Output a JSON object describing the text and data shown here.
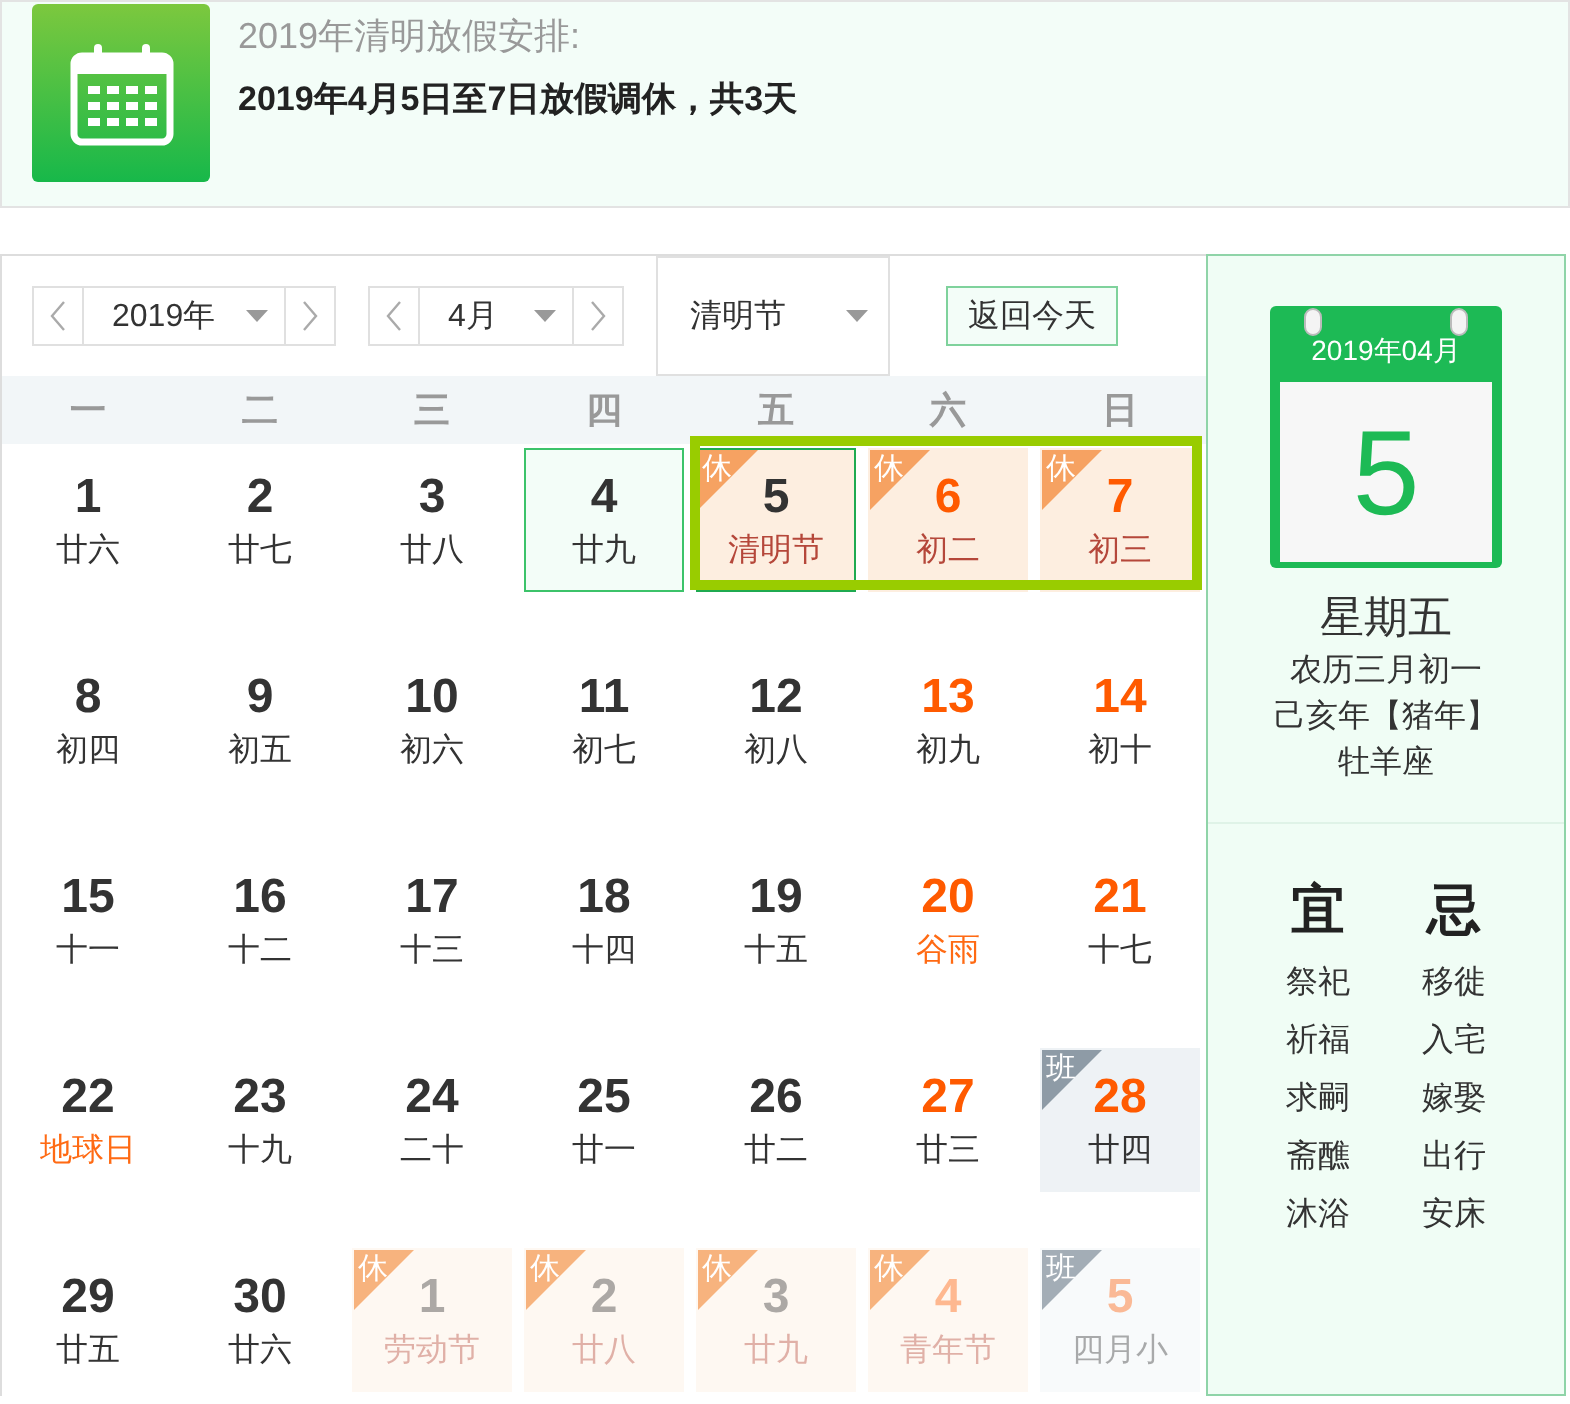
{
  "banner": {
    "title": "2019年清明放假安排:",
    "summary": "2019年4月5日至7日放假调休，共3天"
  },
  "controls": {
    "year_select": {
      "value": "2019年"
    },
    "month_select": {
      "value": "4月"
    },
    "festival_select": {
      "value": "清明节"
    },
    "today_button": "返回今天"
  },
  "weekdays": [
    "一",
    "二",
    "三",
    "四",
    "五",
    "六",
    "日"
  ],
  "weeks": [
    {
      "days": [
        {
          "day": "1",
          "lunar": "廿六",
          "weekend": false,
          "festival": false,
          "other_month": false,
          "today": false,
          "selected": false,
          "outlined": false
        },
        {
          "day": "2",
          "lunar": "廿七",
          "weekend": false,
          "festival": false,
          "other_month": false,
          "today": false,
          "selected": false,
          "outlined": false
        },
        {
          "day": "3",
          "lunar": "廿八",
          "weekend": false,
          "festival": false,
          "other_month": false,
          "today": false,
          "selected": false,
          "outlined": false
        },
        {
          "day": "4",
          "lunar": "廿九",
          "weekend": false,
          "festival": false,
          "other_month": false,
          "today": true,
          "selected": false,
          "outlined": false
        },
        {
          "day": "5",
          "lunar": "清明节",
          "weekend": false,
          "festival": true,
          "other_month": false,
          "today": false,
          "selected": true,
          "outlined": true,
          "tag": {
            "kind": "rest",
            "label": "休"
          }
        },
        {
          "day": "6",
          "lunar": "初二",
          "weekend": true,
          "festival": false,
          "other_month": false,
          "today": false,
          "selected": false,
          "outlined": true,
          "tag": {
            "kind": "rest",
            "label": "休"
          }
        },
        {
          "day": "7",
          "lunar": "初三",
          "weekend": true,
          "festival": false,
          "other_month": false,
          "today": false,
          "selected": false,
          "outlined": true,
          "tag": {
            "kind": "rest",
            "label": "休"
          }
        }
      ]
    },
    {
      "days": [
        {
          "day": "8",
          "lunar": "初四",
          "weekend": false,
          "festival": false,
          "other_month": false,
          "today": false,
          "selected": false,
          "outlined": false
        },
        {
          "day": "9",
          "lunar": "初五",
          "weekend": false,
          "festival": false,
          "other_month": false,
          "today": false,
          "selected": false,
          "outlined": false
        },
        {
          "day": "10",
          "lunar": "初六",
          "weekend": false,
          "festival": false,
          "other_month": false,
          "today": false,
          "selected": false,
          "outlined": false
        },
        {
          "day": "11",
          "lunar": "初七",
          "weekend": false,
          "festival": false,
          "other_month": false,
          "today": false,
          "selected": false,
          "outlined": false
        },
        {
          "day": "12",
          "lunar": "初八",
          "weekend": false,
          "festival": false,
          "other_month": false,
          "today": false,
          "selected": false,
          "outlined": false
        },
        {
          "day": "13",
          "lunar": "初九",
          "weekend": true,
          "festival": false,
          "other_month": false,
          "today": false,
          "selected": false,
          "outlined": false
        },
        {
          "day": "14",
          "lunar": "初十",
          "weekend": true,
          "festival": false,
          "other_month": false,
          "today": false,
          "selected": false,
          "outlined": false
        }
      ]
    },
    {
      "days": [
        {
          "day": "15",
          "lunar": "十一",
          "weekend": false,
          "festival": false,
          "other_month": false,
          "today": false,
          "selected": false,
          "outlined": false
        },
        {
          "day": "16",
          "lunar": "十二",
          "weekend": false,
          "festival": false,
          "other_month": false,
          "today": false,
          "selected": false,
          "outlined": false
        },
        {
          "day": "17",
          "lunar": "十三",
          "weekend": false,
          "festival": false,
          "other_month": false,
          "today": false,
          "selected": false,
          "outlined": false
        },
        {
          "day": "18",
          "lunar": "十四",
          "weekend": false,
          "festival": false,
          "other_month": false,
          "today": false,
          "selected": false,
          "outlined": false
        },
        {
          "day": "19",
          "lunar": "十五",
          "weekend": false,
          "festival": false,
          "other_month": false,
          "today": false,
          "selected": false,
          "outlined": false
        },
        {
          "day": "20",
          "lunar": "谷雨",
          "weekend": true,
          "festival": true,
          "other_month": false,
          "today": false,
          "selected": false,
          "outlined": false
        },
        {
          "day": "21",
          "lunar": "十七",
          "weekend": true,
          "festival": false,
          "other_month": false,
          "today": false,
          "selected": false,
          "outlined": false
        }
      ]
    },
    {
      "days": [
        {
          "day": "22",
          "lunar": "地球日",
          "weekend": false,
          "festival": true,
          "other_month": false,
          "today": false,
          "selected": false,
          "outlined": false
        },
        {
          "day": "23",
          "lunar": "十九",
          "weekend": false,
          "festival": false,
          "other_month": false,
          "today": false,
          "selected": false,
          "outlined": false
        },
        {
          "day": "24",
          "lunar": "二十",
          "weekend": false,
          "festival": false,
          "other_month": false,
          "today": false,
          "selected": false,
          "outlined": false
        },
        {
          "day": "25",
          "lunar": "廿一",
          "weekend": false,
          "festival": false,
          "other_month": false,
          "today": false,
          "selected": false,
          "outlined": false
        },
        {
          "day": "26",
          "lunar": "廿二",
          "weekend": false,
          "festival": false,
          "other_month": false,
          "today": false,
          "selected": false,
          "outlined": false
        },
        {
          "day": "27",
          "lunar": "廿三",
          "weekend": true,
          "festival": false,
          "other_month": false,
          "today": false,
          "selected": false,
          "outlined": false
        },
        {
          "day": "28",
          "lunar": "廿四",
          "weekend": true,
          "festival": false,
          "other_month": false,
          "today": false,
          "selected": false,
          "outlined": false,
          "tag": {
            "kind": "work",
            "label": "班"
          }
        }
      ]
    },
    {
      "days": [
        {
          "day": "29",
          "lunar": "廿五",
          "weekend": false,
          "festival": false,
          "other_month": false,
          "today": false,
          "selected": false,
          "outlined": false
        },
        {
          "day": "30",
          "lunar": "廿六",
          "weekend": false,
          "festival": false,
          "other_month": false,
          "today": false,
          "selected": false,
          "outlined": false
        },
        {
          "day": "1",
          "lunar": "劳动节",
          "weekend": false,
          "festival": true,
          "other_month": true,
          "today": false,
          "selected": false,
          "outlined": false,
          "tag": {
            "kind": "rest",
            "label": "休"
          }
        },
        {
          "day": "2",
          "lunar": "廿八",
          "weekend": false,
          "festival": false,
          "other_month": true,
          "today": false,
          "selected": false,
          "outlined": false,
          "tag": {
            "kind": "rest",
            "label": "休"
          }
        },
        {
          "day": "3",
          "lunar": "廿九",
          "weekend": false,
          "festival": false,
          "other_month": true,
          "today": false,
          "selected": false,
          "outlined": false,
          "tag": {
            "kind": "rest",
            "label": "休"
          }
        },
        {
          "day": "4",
          "lunar": "青年节",
          "weekend": true,
          "festival": true,
          "other_month": true,
          "today": false,
          "selected": false,
          "outlined": false,
          "tag": {
            "kind": "rest",
            "label": "休"
          }
        },
        {
          "day": "5",
          "lunar": "四月小",
          "weekend": true,
          "festival": false,
          "other_month": true,
          "today": false,
          "selected": false,
          "outlined": false,
          "tag": {
            "kind": "work",
            "label": "班"
          }
        }
      ]
    }
  ],
  "detail": {
    "month_header": "2019年04月",
    "day": "5",
    "weekday": "星期五",
    "lunar": "农历三月初一",
    "year": "己亥年【猪年】",
    "zodiac": "牡羊座"
  },
  "almanac": {
    "good": {
      "title": "宜",
      "items": [
        "祭祀",
        "祈福",
        "求嗣",
        "斋醮",
        "沐浴"
      ]
    },
    "bad": {
      "title": "忌",
      "items": [
        "移徙",
        "入宅",
        "嫁娶",
        "出行",
        "安床"
      ]
    }
  }
}
